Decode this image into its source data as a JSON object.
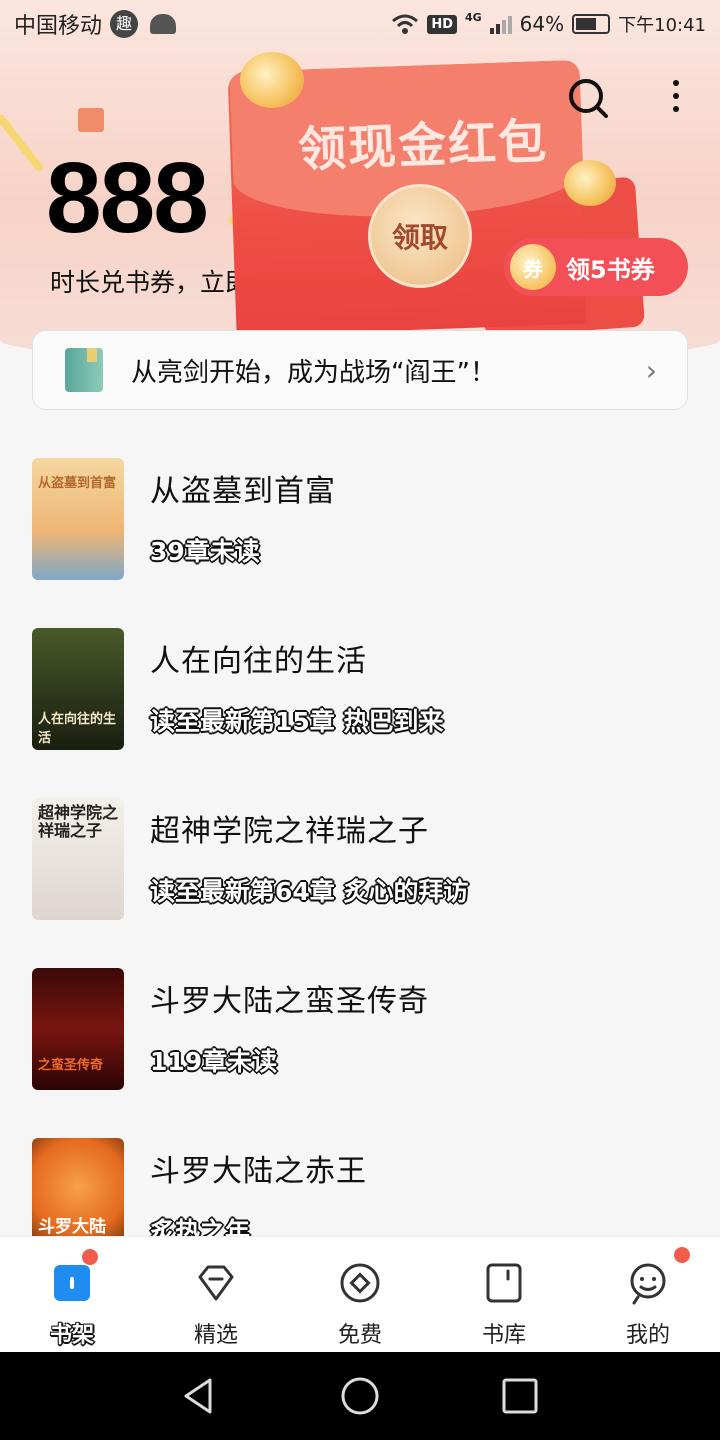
{
  "status_bar": {
    "carrier": "中国移动",
    "carrier_badge": "趣",
    "network": "HD",
    "network_gen": "4G",
    "battery": "64%",
    "time": "下午10:41"
  },
  "header": {
    "points": "888",
    "exchange_text": "时长兑书券，立即兑换",
    "exchange_arrow": ">",
    "envelope_title": "领现金红包",
    "claim_label": "领取",
    "voucher_icon_label": "券",
    "voucher_label": "领5书券"
  },
  "notice": {
    "text": "从亮剑开始，成为战场“阎王”！",
    "chevron": "›"
  },
  "books": [
    {
      "title": "从盗墓到首富",
      "progress": "39章未读",
      "cover_text": "从盗墓到首富",
      "cover_color": "#f2c98e"
    },
    {
      "title": "人在向往的生活",
      "progress": "读至最新第15章 热巴到来",
      "cover_text": "人在向往的生活",
      "cover_color": "#3a4622"
    },
    {
      "title": "超神学院之祥瑞之子",
      "progress": "读至最新第64章 炙心的拜访",
      "cover_text": "超神学院之祥瑞之子",
      "cover_color": "#eae6e2"
    },
    {
      "title": "斗罗大陆之蛮圣传奇",
      "progress": "119章未读",
      "cover_text": "之蛮圣传奇",
      "cover_color": "#5a0e0c"
    },
    {
      "title": "斗罗大陆之赤王",
      "progress": "炙热之年",
      "cover_text": "斗罗大陆",
      "cover_color": "#e9762c"
    }
  ],
  "tabs": [
    {
      "label": "书架",
      "icon": "bookshelf-icon",
      "active": true,
      "dot": true
    },
    {
      "label": "精选",
      "icon": "diamond-icon",
      "active": false,
      "dot": false
    },
    {
      "label": "免费",
      "icon": "coin-icon",
      "active": false,
      "dot": false
    },
    {
      "label": "书库",
      "icon": "library-icon",
      "active": false,
      "dot": false
    },
    {
      "label": "我的",
      "icon": "profile-icon",
      "active": false,
      "dot": true
    }
  ],
  "colors": {
    "accent_red": "#f25056",
    "envelope": "#ee4e46",
    "tab_active": "#1e8cf0"
  }
}
